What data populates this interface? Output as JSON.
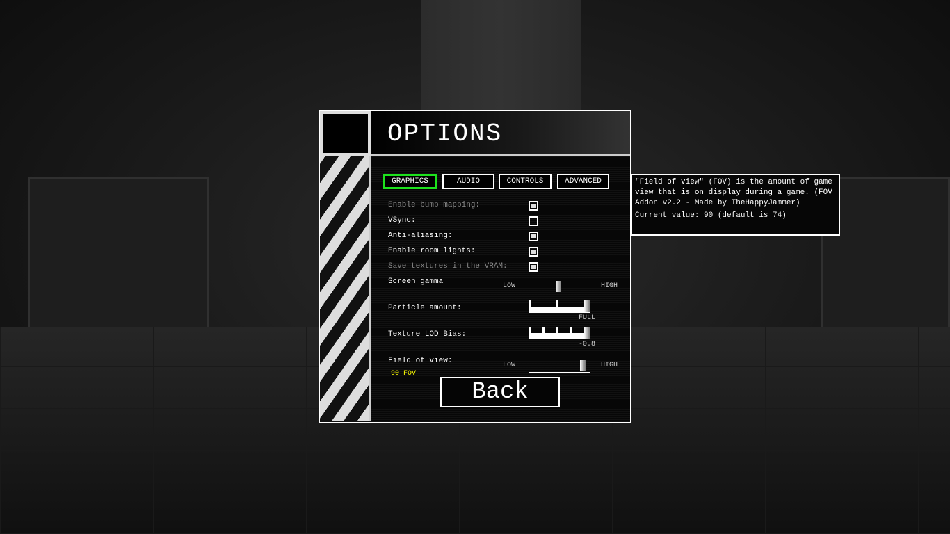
{
  "title": "OPTIONS",
  "tabs": [
    {
      "label": "GRAPHICS",
      "active": true
    },
    {
      "label": "AUDIO"
    },
    {
      "label": "CONTROLS"
    },
    {
      "label": "ADVANCED"
    }
  ],
  "accent_color": "#1de21d",
  "checkboxes": [
    {
      "label": "Enable bump mapping:",
      "checked": true,
      "disabled": true
    },
    {
      "label": "VSync:",
      "checked": false
    },
    {
      "label": "Anti-aliasing:",
      "checked": true
    },
    {
      "label": "Enable room lights:",
      "checked": true
    },
    {
      "label": "Save textures in the VRAM:",
      "checked": true,
      "disabled": true
    }
  ],
  "sliders": {
    "gamma": {
      "label": "Screen gamma",
      "low": "LOW",
      "high": "HIGH",
      "value_fraction": 0.48
    },
    "particles": {
      "label": "Particle amount:",
      "value_text": "FULL",
      "steps": 3,
      "step": 3
    },
    "lod": {
      "label": "Texture LOD Bias:",
      "value_text": "-0.8",
      "steps": 5,
      "step": 5
    },
    "fov": {
      "label": "Field of view:",
      "low": "LOW",
      "high": "HIGH",
      "value_fraction": 0.93,
      "value_text": "90 FOV",
      "value_color": "#ffff00"
    }
  },
  "back_label": "Back",
  "tooltip": {
    "text": "\"Field of view\" (FOV) is the amount of game view that is on display during a game. (FOV Addon v2.2 - Made by TheHappyJammer)",
    "current": "Current value: 90 (default is 74)"
  }
}
